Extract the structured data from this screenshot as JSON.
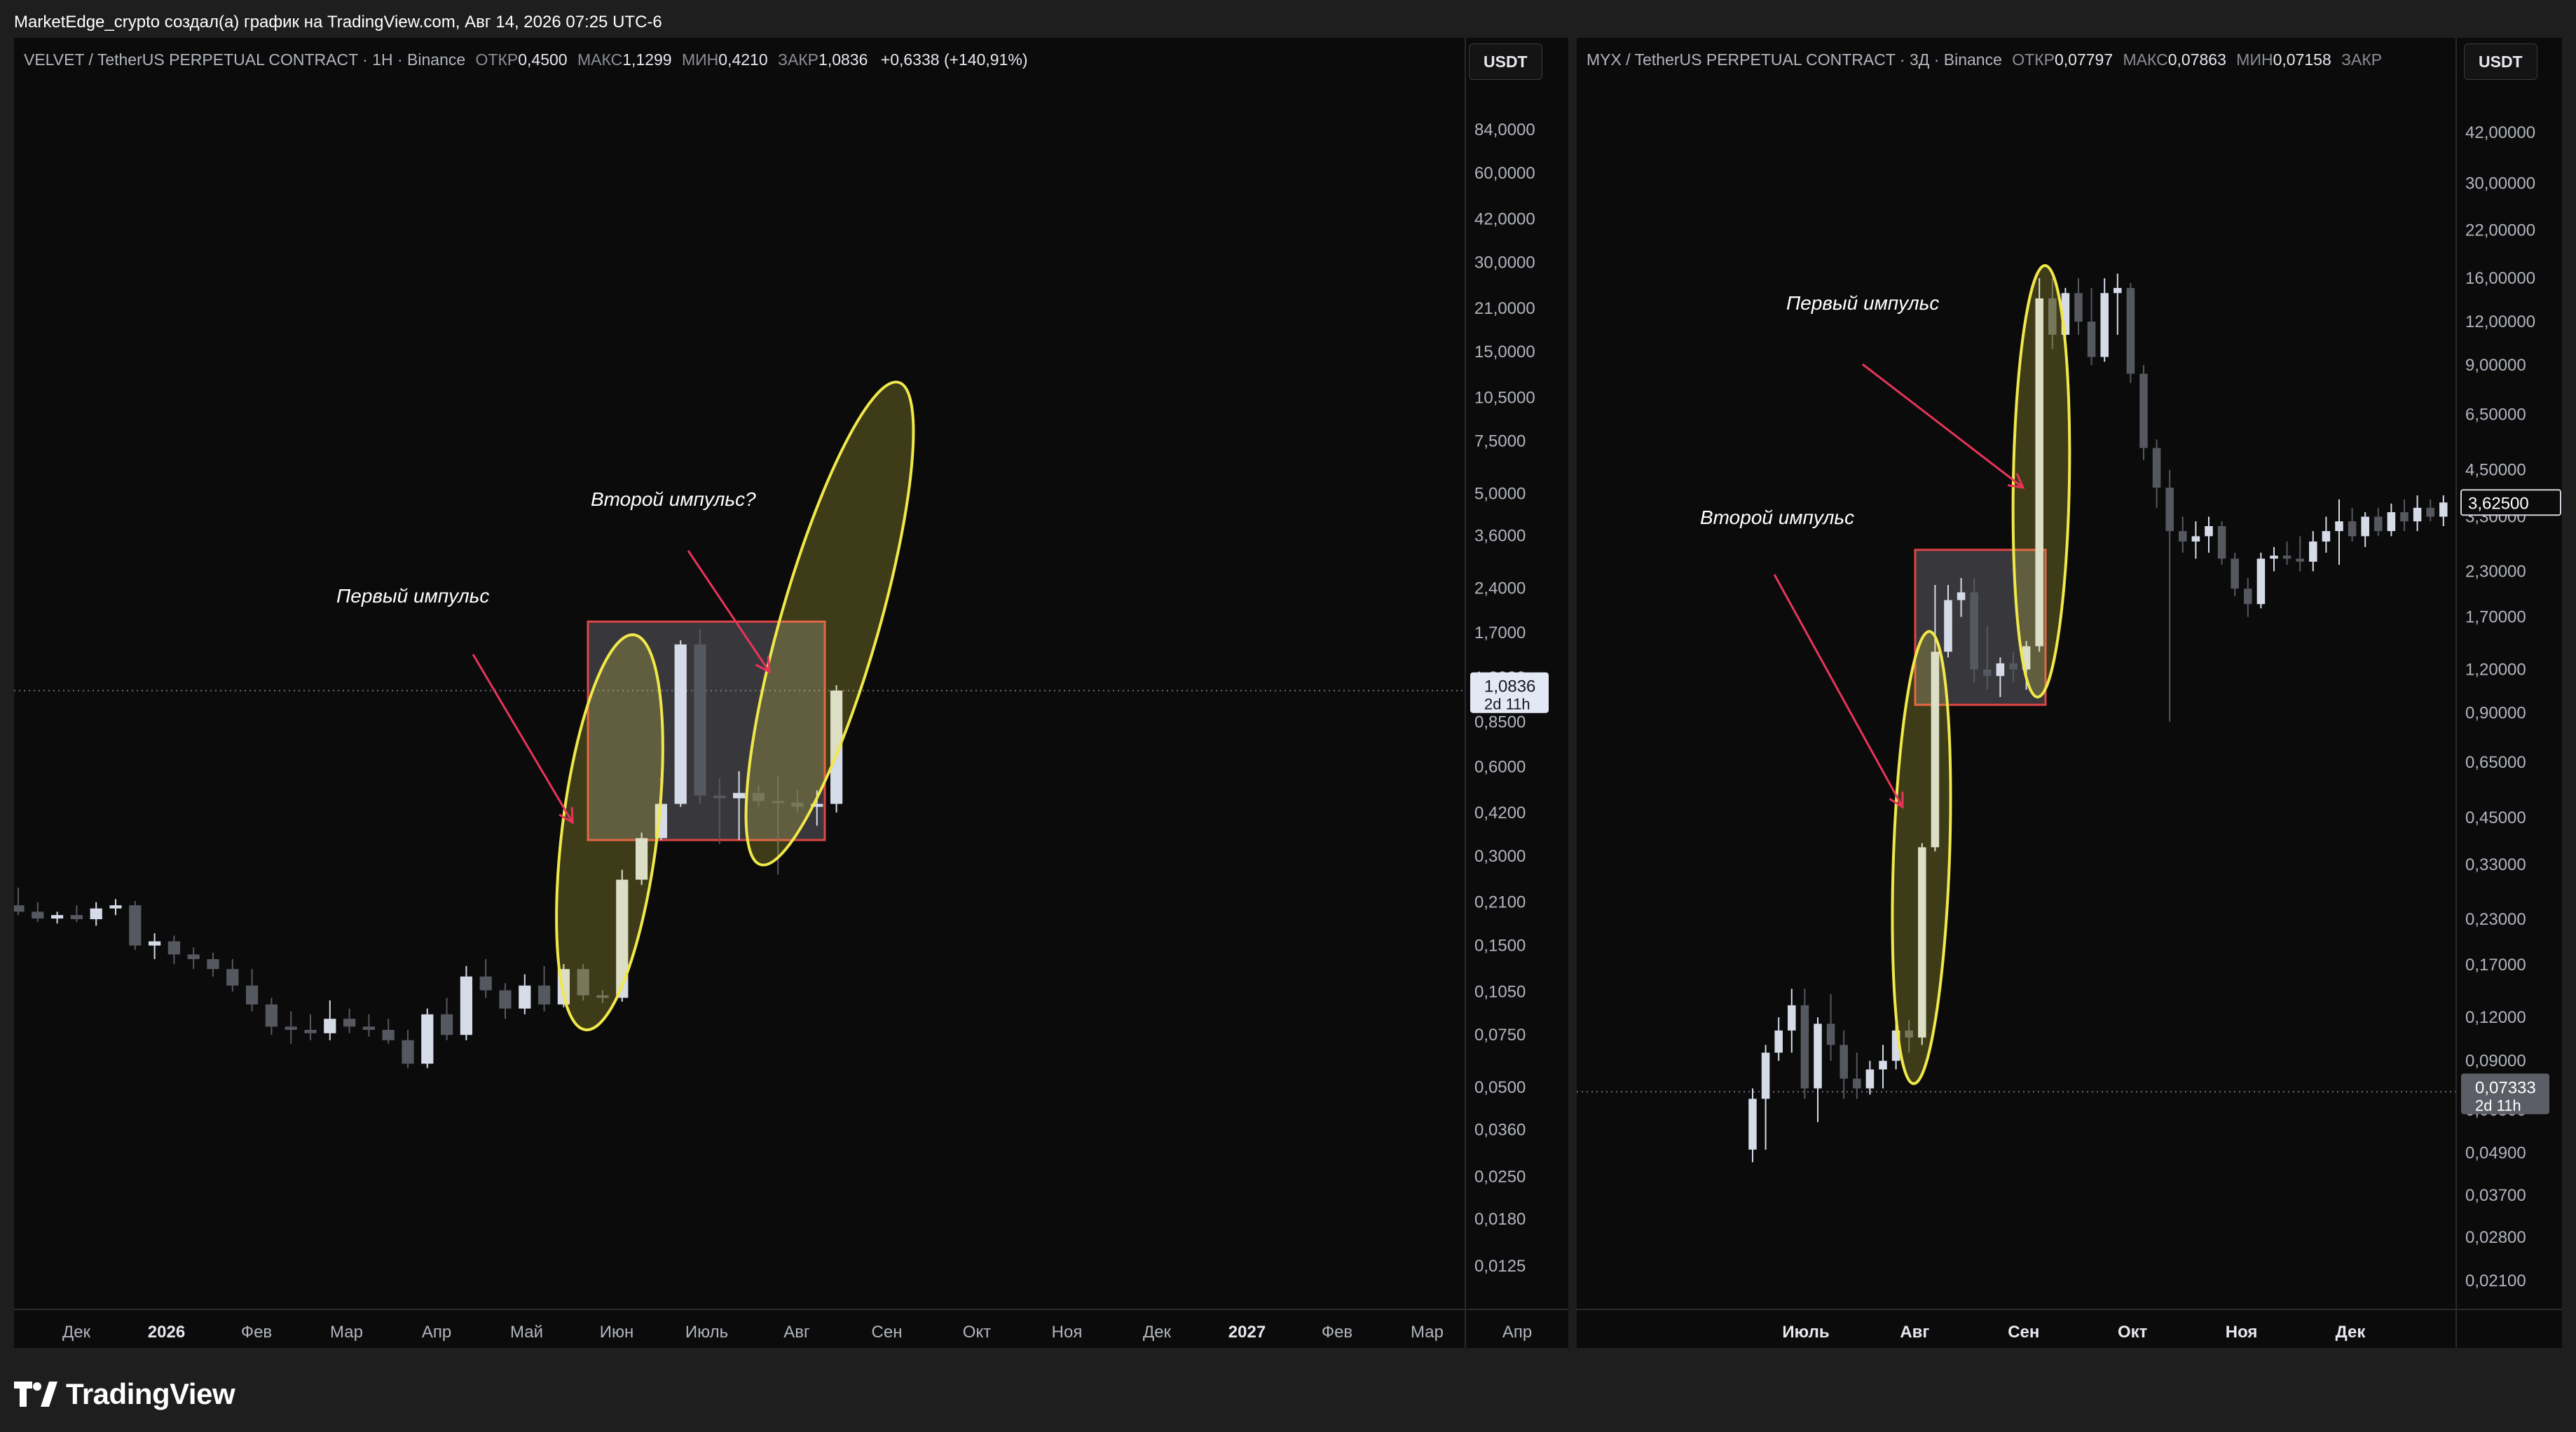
{
  "attribution": "MarketEdge_crypto создал(а) график на TradingView.com, Авг 14, 2026 07:25 UTC-6",
  "brand": "TradingView",
  "colors": {
    "background": "#0b0b0b",
    "candle_up": "#d6dbe8",
    "candle_down": "#55585f",
    "ellipse": "#f0e84a",
    "arrow": "#e8345a",
    "box": "#e04545"
  },
  "left_chart": {
    "legend": {
      "symbol": "VELVET / TetherUS PERPETUAL CONTRACT · 1H · Binance",
      "open_label": "ОТКР",
      "open": "0,4500",
      "high_label": "МАКС",
      "high": "1,1299",
      "low_label": "МИН",
      "low": "0,4210",
      "close_label": "ЗАКР",
      "close": "1,0836",
      "change": "+0,6338 (+140,91%)"
    },
    "currency_button": "USDT",
    "price_ticks": [
      "84,0000",
      "60,0000",
      "42,0000",
      "30,0000",
      "21,0000",
      "15,0000",
      "10,5000",
      "7,5000",
      "5,0000",
      "3,6000",
      "2,4000",
      "1,7000",
      "1,2000",
      "0,8500",
      "0,6000",
      "0,4200",
      "0,3000",
      "0,2100",
      "0,1500",
      "0,1050",
      "0,0750",
      "0,0500",
      "0,0360",
      "0,0250",
      "0,0180",
      "0,0125"
    ],
    "current_price": "1,0836",
    "countdown": "2d 11h",
    "time_ticks": [
      {
        "t": "Дек",
        "bold": false
      },
      {
        "t": "2026",
        "bold": true
      },
      {
        "t": "Фев",
        "bold": false
      },
      {
        "t": "Мар",
        "bold": false
      },
      {
        "t": "Апр",
        "bold": false
      },
      {
        "t": "Май",
        "bold": false
      },
      {
        "t": "Июн",
        "bold": false
      },
      {
        "t": "Июль",
        "bold": false
      },
      {
        "t": "Авг",
        "bold": false
      },
      {
        "t": "Сен",
        "bold": false
      },
      {
        "t": "Окт",
        "bold": false
      },
      {
        "t": "Ноя",
        "bold": false
      },
      {
        "t": "Дек",
        "bold": false
      },
      {
        "t": "2027",
        "bold": true
      },
      {
        "t": "Фев",
        "bold": false
      },
      {
        "t": "Мар",
        "bold": false
      },
      {
        "t": "Апр",
        "bold": false
      }
    ],
    "annotations": [
      "Первый импульс",
      "Второй импульс?"
    ],
    "candles": [
      {
        "o": 0.205,
        "h": 0.235,
        "l": 0.19,
        "c": 0.195
      },
      {
        "o": 0.195,
        "h": 0.21,
        "l": 0.18,
        "c": 0.185
      },
      {
        "o": 0.185,
        "h": 0.195,
        "l": 0.178,
        "c": 0.19
      },
      {
        "o": 0.19,
        "h": 0.205,
        "l": 0.18,
        "c": 0.184
      },
      {
        "o": 0.184,
        "h": 0.21,
        "l": 0.175,
        "c": 0.2
      },
      {
        "o": 0.2,
        "h": 0.215,
        "l": 0.19,
        "c": 0.205
      },
      {
        "o": 0.205,
        "h": 0.212,
        "l": 0.145,
        "c": 0.15
      },
      {
        "o": 0.15,
        "h": 0.165,
        "l": 0.135,
        "c": 0.155
      },
      {
        "o": 0.155,
        "h": 0.162,
        "l": 0.13,
        "c": 0.14
      },
      {
        "o": 0.14,
        "h": 0.148,
        "l": 0.125,
        "c": 0.135
      },
      {
        "o": 0.135,
        "h": 0.142,
        "l": 0.118,
        "c": 0.125
      },
      {
        "o": 0.125,
        "h": 0.135,
        "l": 0.105,
        "c": 0.11
      },
      {
        "o": 0.11,
        "h": 0.125,
        "l": 0.09,
        "c": 0.095
      },
      {
        "o": 0.095,
        "h": 0.1,
        "l": 0.075,
        "c": 0.08
      },
      {
        "o": 0.08,
        "h": 0.09,
        "l": 0.07,
        "c": 0.078
      },
      {
        "o": 0.078,
        "h": 0.088,
        "l": 0.072,
        "c": 0.076
      },
      {
        "o": 0.076,
        "h": 0.098,
        "l": 0.072,
        "c": 0.085
      },
      {
        "o": 0.085,
        "h": 0.092,
        "l": 0.076,
        "c": 0.08
      },
      {
        "o": 0.08,
        "h": 0.088,
        "l": 0.074,
        "c": 0.078
      },
      {
        "o": 0.078,
        "h": 0.085,
        "l": 0.07,
        "c": 0.072
      },
      {
        "o": 0.072,
        "h": 0.078,
        "l": 0.058,
        "c": 0.06
      },
      {
        "o": 0.06,
        "h": 0.092,
        "l": 0.058,
        "c": 0.088
      },
      {
        "o": 0.088,
        "h": 0.1,
        "l": 0.072,
        "c": 0.075
      },
      {
        "o": 0.075,
        "h": 0.128,
        "l": 0.072,
        "c": 0.118
      },
      {
        "o": 0.118,
        "h": 0.135,
        "l": 0.1,
        "c": 0.106
      },
      {
        "o": 0.106,
        "h": 0.112,
        "l": 0.085,
        "c": 0.092
      },
      {
        "o": 0.092,
        "h": 0.12,
        "l": 0.088,
        "c": 0.11
      },
      {
        "o": 0.11,
        "h": 0.128,
        "l": 0.09,
        "c": 0.095
      },
      {
        "o": 0.095,
        "h": 0.13,
        "l": 0.093,
        "c": 0.125
      },
      {
        "o": 0.125,
        "h": 0.13,
        "l": 0.098,
        "c": 0.102
      },
      {
        "o": 0.102,
        "h": 0.106,
        "l": 0.096,
        "c": 0.1
      },
      {
        "o": 0.1,
        "h": 0.27,
        "l": 0.097,
        "c": 0.25
      },
      {
        "o": 0.25,
        "h": 0.36,
        "l": 0.24,
        "c": 0.345
      },
      {
        "o": 0.345,
        "h": 0.55,
        "l": 0.34,
        "c": 0.45
      },
      {
        "o": 0.45,
        "h": 1.6,
        "l": 0.44,
        "c": 1.55
      },
      {
        "o": 1.55,
        "h": 1.75,
        "l": 0.45,
        "c": 0.48
      },
      {
        "o": 0.48,
        "h": 0.55,
        "l": 0.33,
        "c": 0.47
      },
      {
        "o": 0.47,
        "h": 0.58,
        "l": 0.34,
        "c": 0.49
      },
      {
        "o": 0.49,
        "h": 0.52,
        "l": 0.44,
        "c": 0.46
      },
      {
        "o": 0.46,
        "h": 0.56,
        "l": 0.26,
        "c": 0.455
      },
      {
        "o": 0.455,
        "h": 0.5,
        "l": 0.42,
        "c": 0.44
      },
      {
        "o": 0.44,
        "h": 0.5,
        "l": 0.38,
        "c": 0.45
      },
      {
        "o": 0.45,
        "h": 1.1299,
        "l": 0.421,
        "c": 1.0836
      }
    ]
  },
  "right_chart": {
    "legend": {
      "symbol": "MYX / TetherUS PERPETUAL CONTRACT · 3Д · Binance",
      "open_label": "ОТКР",
      "open": "0,07797",
      "high_label": "МАКС",
      "high": "0,07863",
      "low_label": "МИН",
      "low": "0,07158",
      "close_label": "ЗАКР"
    },
    "currency_button": "USDT",
    "price_ticks": [
      "42,00000",
      "30,00000",
      "22,00000",
      "16,00000",
      "12,00000",
      "9,00000",
      "6,50000",
      "4,50000",
      "3,30000",
      "2,30000",
      "1,70000",
      "1,20000",
      "0,90000",
      "0,65000",
      "0,45000",
      "0,33000",
      "0,23000",
      "0,17000",
      "0,12000",
      "0,09000",
      "0,06500",
      "0,04900",
      "0,03700",
      "0,02800",
      "0,02100"
    ],
    "last_marker": "3,62500",
    "current_price": "0,07333",
    "countdown": "2d 11h",
    "time_ticks": [
      {
        "t": "Июль",
        "bold": true
      },
      {
        "t": "Авг",
        "bold": true
      },
      {
        "t": "Сен",
        "bold": true
      },
      {
        "t": "Окт",
        "bold": true
      },
      {
        "t": "Ноя",
        "bold": true
      },
      {
        "t": "Дек",
        "bold": true
      }
    ],
    "annotations": [
      "Второй импульс",
      "Первый импульс"
    ],
    "candles": [
      {
        "o": 0.05,
        "h": 0.075,
        "l": 0.046,
        "c": 0.07
      },
      {
        "o": 0.07,
        "h": 0.1,
        "l": 0.05,
        "c": 0.095
      },
      {
        "o": 0.095,
        "h": 0.12,
        "l": 0.09,
        "c": 0.11
      },
      {
        "o": 0.11,
        "h": 0.145,
        "l": 0.095,
        "c": 0.13
      },
      {
        "o": 0.13,
        "h": 0.145,
        "l": 0.07,
        "c": 0.075
      },
      {
        "o": 0.075,
        "h": 0.12,
        "l": 0.06,
        "c": 0.115
      },
      {
        "o": 0.115,
        "h": 0.14,
        "l": 0.09,
        "c": 0.1
      },
      {
        "o": 0.1,
        "h": 0.11,
        "l": 0.07,
        "c": 0.08
      },
      {
        "o": 0.08,
        "h": 0.095,
        "l": 0.07,
        "c": 0.075
      },
      {
        "o": 0.075,
        "h": 0.09,
        "l": 0.072,
        "c": 0.085
      },
      {
        "o": 0.085,
        "h": 0.1,
        "l": 0.075,
        "c": 0.09
      },
      {
        "o": 0.09,
        "h": 0.12,
        "l": 0.085,
        "c": 0.11
      },
      {
        "o": 0.11,
        "h": 0.118,
        "l": 0.095,
        "c": 0.105
      },
      {
        "o": 0.105,
        "h": 0.38,
        "l": 0.1,
        "c": 0.37
      },
      {
        "o": 0.37,
        "h": 2.1,
        "l": 0.36,
        "c": 1.35
      },
      {
        "o": 1.35,
        "h": 2.1,
        "l": 1.3,
        "c": 1.9
      },
      {
        "o": 1.9,
        "h": 2.2,
        "l": 1.7,
        "c": 2.0
      },
      {
        "o": 2.0,
        "h": 2.2,
        "l": 1.1,
        "c": 1.2
      },
      {
        "o": 1.2,
        "h": 1.6,
        "l": 1.05,
        "c": 1.15
      },
      {
        "o": 1.15,
        "h": 1.3,
        "l": 1.0,
        "c": 1.25
      },
      {
        "o": 1.25,
        "h": 1.35,
        "l": 1.1,
        "c": 1.2
      },
      {
        "o": 1.2,
        "h": 1.45,
        "l": 1.05,
        "c": 1.4
      },
      {
        "o": 1.4,
        "h": 16.0,
        "l": 1.35,
        "c": 14.0
      },
      {
        "o": 14.0,
        "h": 16.0,
        "l": 10.0,
        "c": 11.0
      },
      {
        "o": 11.0,
        "h": 15.0,
        "l": 10.5,
        "c": 14.5
      },
      {
        "o": 14.5,
        "h": 16.0,
        "l": 11.0,
        "c": 12.0
      },
      {
        "o": 12.0,
        "h": 15.0,
        "l": 9.0,
        "c": 9.5
      },
      {
        "o": 9.5,
        "h": 16.0,
        "l": 9.2,
        "c": 14.5
      },
      {
        "o": 14.5,
        "h": 16.5,
        "l": 11.0,
        "c": 15.0
      },
      {
        "o": 15.0,
        "h": 15.5,
        "l": 8.0,
        "c": 8.5
      },
      {
        "o": 8.5,
        "h": 9.0,
        "l": 4.8,
        "c": 5.2
      },
      {
        "o": 5.2,
        "h": 5.5,
        "l": 3.5,
        "c": 4.0
      },
      {
        "o": 4.0,
        "h": 4.5,
        "l": 0.85,
        "c": 3.0
      },
      {
        "o": 3.0,
        "h": 3.3,
        "l": 2.6,
        "c": 2.8
      },
      {
        "o": 2.8,
        "h": 3.2,
        "l": 2.5,
        "c": 2.9
      },
      {
        "o": 2.9,
        "h": 3.3,
        "l": 2.6,
        "c": 3.1
      },
      {
        "o": 3.1,
        "h": 3.2,
        "l": 2.4,
        "c": 2.5
      },
      {
        "o": 2.5,
        "h": 2.6,
        "l": 1.95,
        "c": 2.05
      },
      {
        "o": 2.05,
        "h": 2.2,
        "l": 1.7,
        "c": 1.85
      },
      {
        "o": 1.85,
        "h": 2.6,
        "l": 1.8,
        "c": 2.5
      },
      {
        "o": 2.5,
        "h": 2.7,
        "l": 2.3,
        "c": 2.55
      },
      {
        "o": 2.55,
        "h": 2.8,
        "l": 2.4,
        "c": 2.5
      },
      {
        "o": 2.5,
        "h": 2.9,
        "l": 2.3,
        "c": 2.45
      },
      {
        "o": 2.45,
        "h": 3.0,
        "l": 2.3,
        "c": 2.8
      },
      {
        "o": 2.8,
        "h": 3.3,
        "l": 2.6,
        "c": 3.0
      },
      {
        "o": 3.0,
        "h": 3.7,
        "l": 2.4,
        "c": 3.2
      },
      {
        "o": 3.2,
        "h": 3.5,
        "l": 2.8,
        "c": 2.9
      },
      {
        "o": 2.9,
        "h": 3.4,
        "l": 2.7,
        "c": 3.3
      },
      {
        "o": 3.3,
        "h": 3.5,
        "l": 2.9,
        "c": 3.0
      },
      {
        "o": 3.0,
        "h": 3.6,
        "l": 2.9,
        "c": 3.4
      },
      {
        "o": 3.4,
        "h": 3.7,
        "l": 3.0,
        "c": 3.2
      },
      {
        "o": 3.2,
        "h": 3.8,
        "l": 3.0,
        "c": 3.5
      },
      {
        "o": 3.5,
        "h": 3.7,
        "l": 3.2,
        "c": 3.3
      },
      {
        "o": 3.3,
        "h": 3.8,
        "l": 3.1,
        "c": 3.625
      }
    ]
  }
}
